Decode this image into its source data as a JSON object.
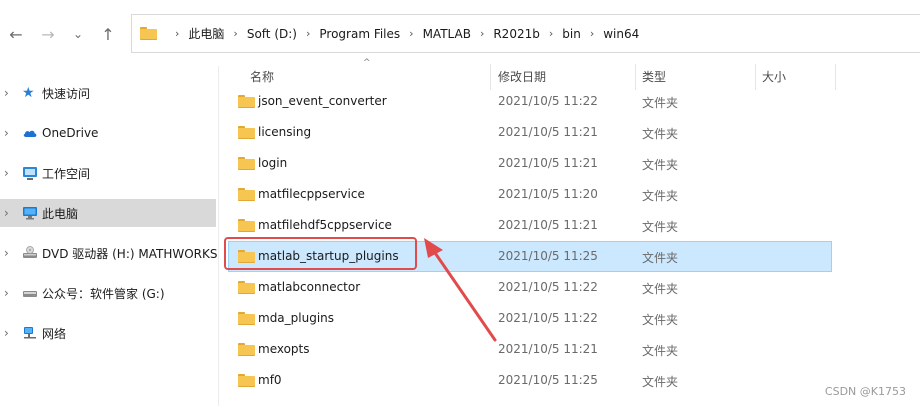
{
  "nav": {
    "back": "←",
    "forward": "→",
    "recent": "⌄",
    "up": "↑"
  },
  "address": {
    "crumbs": [
      "此电脑",
      "Soft (D:)",
      "Program Files",
      "MATLAB",
      "R2021b",
      "bin",
      "win64"
    ],
    "separator": "›"
  },
  "sidebar": {
    "chevron": "›",
    "items": [
      {
        "label": "快速访问"
      },
      {
        "label": "OneDrive"
      },
      {
        "label": "工作空间"
      },
      {
        "label": "此电脑"
      },
      {
        "label": "DVD 驱动器 (H:) MATHWORKS"
      },
      {
        "label": "公众号：软件管家 (G:)"
      },
      {
        "label": "网络"
      }
    ]
  },
  "columns": {
    "name": "名称",
    "date": "修改日期",
    "type": "类型",
    "size": "大小",
    "sort_indicator": "^"
  },
  "files": [
    {
      "name": "json_event_converter",
      "date": "2021/10/5 11:22",
      "type": "文件夹"
    },
    {
      "name": "licensing",
      "date": "2021/10/5 11:21",
      "type": "文件夹"
    },
    {
      "name": "login",
      "date": "2021/10/5 11:21",
      "type": "文件夹"
    },
    {
      "name": "matfilecppservice",
      "date": "2021/10/5 11:20",
      "type": "文件夹"
    },
    {
      "name": "matfilehdf5cppservice",
      "date": "2021/10/5 11:21",
      "type": "文件夹"
    },
    {
      "name": "matlab_startup_plugins",
      "date": "2021/10/5 11:25",
      "type": "文件夹"
    },
    {
      "name": "matlabconnector",
      "date": "2021/10/5 11:22",
      "type": "文件夹"
    },
    {
      "name": "mda_plugins",
      "date": "2021/10/5 11:22",
      "type": "文件夹"
    },
    {
      "name": "mexopts",
      "date": "2021/10/5 11:21",
      "type": "文件夹"
    },
    {
      "name": "mf0",
      "date": "2021/10/5 11:25",
      "type": "文件夹"
    }
  ],
  "selected_file": "matlab_startup_plugins",
  "colors": {
    "selection_bg": "#cce8ff",
    "annotation_red": "#e24b4b",
    "folder_yellow": "#f7c552"
  },
  "watermark": "CSDN @K1753"
}
